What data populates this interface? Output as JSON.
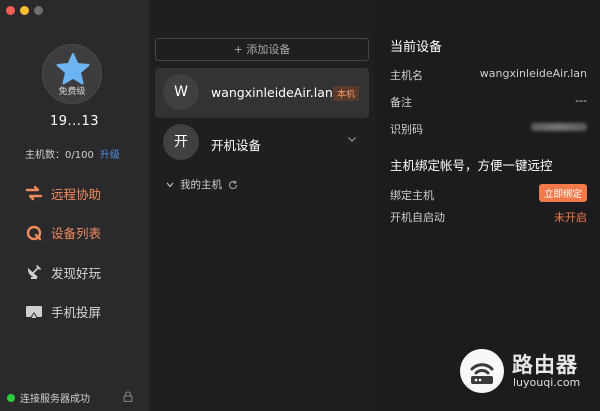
{
  "window": {
    "controls": [
      "close",
      "minimize",
      "zoom"
    ]
  },
  "sidebar": {
    "avatar": {
      "icon": "star-icon",
      "tier": "免费级",
      "star_color": "#6db4f2"
    },
    "user_id": "19...13",
    "host_count": {
      "label": "主机数：0/100",
      "upgrade": "升级"
    },
    "nav": [
      {
        "label": "远程协助",
        "icon": "remote-assist-icon",
        "active": true
      },
      {
        "label": "设备列表",
        "icon": "device-list-icon",
        "active": true
      },
      {
        "label": "发现好玩",
        "icon": "satellite-icon",
        "active": false
      },
      {
        "label": "手机投屏",
        "icon": "screen-cast-icon",
        "active": false
      }
    ],
    "status": "连接服务器成功",
    "accent": "#f08a5d",
    "status_color": "#2ecc40"
  },
  "devices": {
    "add_label": "+ 添加设备",
    "list": [
      {
        "avatar": "W",
        "name": "wangxinleideAir.lan",
        "badge": "本机",
        "selected": true
      },
      {
        "avatar": "开",
        "name": "开机设备",
        "badge": "",
        "selected": false
      }
    ],
    "group": "我的主机"
  },
  "detail": {
    "title": "当前设备",
    "rows": [
      {
        "key": "主机名",
        "value": "wangxinleideAir.lan"
      },
      {
        "key": "备注",
        "value": "---"
      },
      {
        "key": "识别码",
        "value": ""
      }
    ],
    "bind_title": "主机绑定帐号，方便一键远控",
    "bind": {
      "key": "绑定主机",
      "button": "立即绑定"
    },
    "autostart": {
      "key": "开机自启动",
      "value": "未开启"
    }
  },
  "watermark": {
    "cn": "路由器",
    "en": "luyouqi.com"
  }
}
